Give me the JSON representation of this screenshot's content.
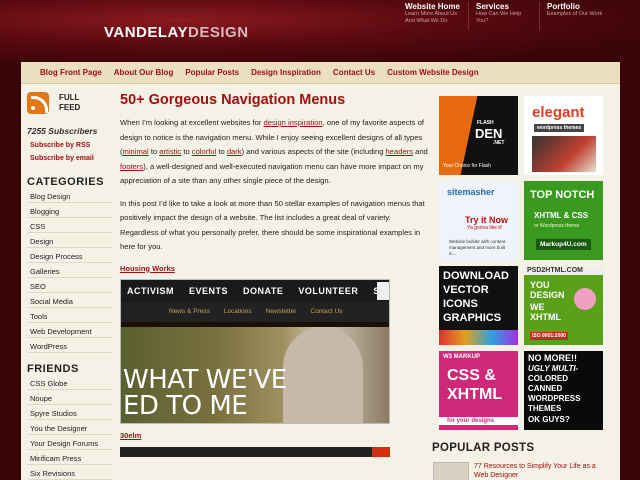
{
  "logo": {
    "part1": "VANDELAY",
    "part2": "DESIGN"
  },
  "topnav": [
    {
      "title": "Website Home",
      "sub": "Learn More About Us And What We Do"
    },
    {
      "title": "Services",
      "sub": "How Can We Help You?"
    },
    {
      "title": "Portfolio",
      "sub": "Examples of Our Work"
    }
  ],
  "nav": [
    "Blog Front Page",
    "About Our Blog",
    "Popular Posts",
    "Design Inspiration",
    "Contact Us",
    "Custom Website Design"
  ],
  "sidebar": {
    "feed_label_1": "FULL",
    "feed_label_2": "FEED",
    "subscribers": "7255 Subscribers",
    "rss_link": "Subscribe by RSS",
    "email_link": "Subscribe by email",
    "categories_title": "CATEGORIES",
    "categories": [
      "Blog Design",
      "Blogging",
      "CSS",
      "Design",
      "Design Process",
      "Galleries",
      "SEO",
      "Social Media",
      "Tools",
      "Web Development",
      "WordPress"
    ],
    "friends_title": "FRIENDS",
    "friends": [
      "CSS Globe",
      "Noupe",
      "Spyre Studios",
      "You the Designer",
      "Your Design Forums",
      "Mirificam Press",
      "Six Revisions"
    ]
  },
  "post": {
    "title": "50+ Gorgeous Navigation Menus",
    "p1_a": "When I’m looking at excellent websites for ",
    "p1_link1": "design inspiration",
    "p1_b": ", one of my favorite aspects of design to notice is the navigation menu. While I enjoy seeing excellent designs of all types (",
    "p1_link2": "minimal",
    "p1_c": " to ",
    "p1_link3": "artistic",
    "p1_d": " to ",
    "p1_link4": "colorful",
    "p1_e": " to ",
    "p1_link5": "dark",
    "p1_f": ") and various aspects of the site (including ",
    "p1_link6": "headers",
    "p1_g": " and ",
    "p1_link7": "footers",
    "p1_h": "), a well-designed and well-executed navigation menu can have more impact on my appreciation of a site than any other single piece of the design.",
    "p2": "In this post I’d like to take a look at more than 50 stellar examples of navigation menus that positively impact the design of a website. The list includes a great deal of variety. Regardless of what you personally prefer, there should be some inspirational examples in here for you.",
    "example1": "Housing Works",
    "example1_menu": [
      "ACTIVISM",
      "EVENTS",
      "DONATE",
      "VOLUNTEER",
      "SERVICES"
    ],
    "example1_sub": [
      "News & Press",
      "Locations",
      "Newsletter",
      "Contact Us"
    ],
    "example1_big_1": "WHAT WE'VE",
    "example1_big_2": "ED TO ME",
    "example2": "30elm"
  },
  "ads": [
    {
      "name": "flashden",
      "l1": "FLASH",
      "l2": "DEN",
      "l3": ".NET",
      "l4": "Your Choice for Flash"
    },
    {
      "name": "elegant",
      "l1": "elegant",
      "l2": "wordpress themes"
    },
    {
      "name": "sitemasher",
      "l1": "sitemasher",
      "l2": "Try it Now",
      "l3": "Ya gonna like it!",
      "l4": "Website builder with content management and more built in..."
    },
    {
      "name": "topnotch",
      "l1": "TOP NOTCH",
      "l2": "XHTML & CSS",
      "l3": "or Wordpress theme",
      "l4": "Markup4U.com"
    },
    {
      "name": "vector",
      "l1": "DOWNLOAD",
      "l2": "VECTOR",
      "l3": "ICONS",
      "l4": "GRAPHICS"
    },
    {
      "name": "psd2html",
      "l1": "PSD2HTML.COM",
      "l2": "YOU",
      "l3": "DESIGN",
      "l4": "WE",
      "l5": "XHTML",
      "l6": "ISO 9001:2000"
    },
    {
      "name": "markup",
      "l1": "W3 MARKUP",
      "l2": "CSS &",
      "l3": "XHTML",
      "l4": "for your designs"
    },
    {
      "name": "nomore",
      "l1": "NO MORE!!",
      "l2": "UGLY MULTI-",
      "l3": "COLORED",
      "l4": "CANNED",
      "l5": "WORDPRESS",
      "l6": "THEMES",
      "l7": "OK GUYS?"
    }
  ],
  "popular": {
    "title": "POPULAR POSTS",
    "first": "77 Resources to Simplify Your Life as a Web Designer"
  },
  "colors": {
    "accent": "#a01010",
    "bg": "#3a0508",
    "panel": "#f4f1e6"
  }
}
